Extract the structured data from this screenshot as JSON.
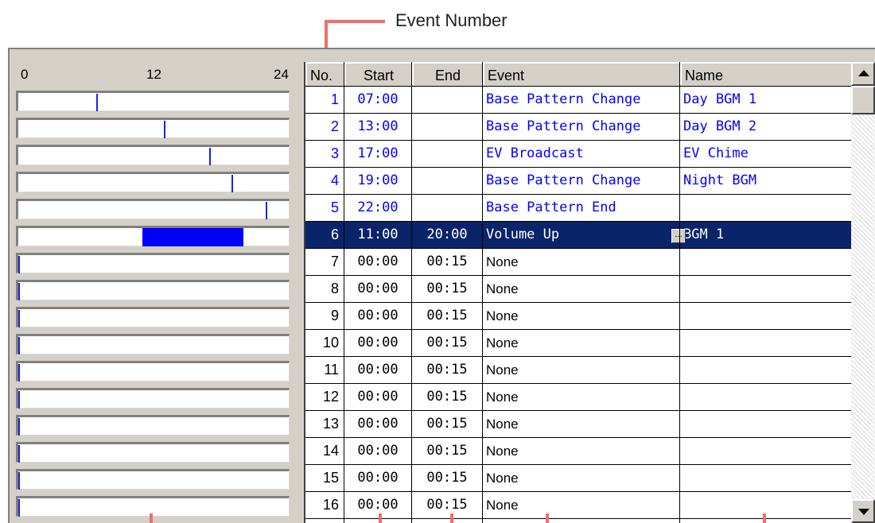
{
  "callout": {
    "label": "Event Number"
  },
  "timeline": {
    "scale": [
      "0",
      "12",
      "24"
    ],
    "range_hours": [
      0,
      24
    ],
    "marks": [
      {
        "type": "line",
        "start": 7
      },
      {
        "type": "line",
        "start": 13
      },
      {
        "type": "line",
        "start": 17
      },
      {
        "type": "line",
        "start": 19
      },
      {
        "type": "line",
        "start": 22
      },
      {
        "type": "bar",
        "start": 11,
        "end": 20
      },
      {
        "type": "line",
        "start": 0
      },
      {
        "type": "line",
        "start": 0
      },
      {
        "type": "line",
        "start": 0
      },
      {
        "type": "line",
        "start": 0
      },
      {
        "type": "line",
        "start": 0
      },
      {
        "type": "line",
        "start": 0
      },
      {
        "type": "line",
        "start": 0
      },
      {
        "type": "line",
        "start": 0
      },
      {
        "type": "line",
        "start": 0
      },
      {
        "type": "line",
        "start": 0
      }
    ]
  },
  "table": {
    "headers": {
      "no": "No.",
      "start": "Start",
      "end": "End",
      "event": "Event",
      "name": "Name"
    },
    "rows": [
      {
        "no": "1",
        "start": "07:00",
        "end": "",
        "event": "Base Pattern Change",
        "name": "Day BGM 1",
        "style": "blue"
      },
      {
        "no": "2",
        "start": "13:00",
        "end": "",
        "event": "Base Pattern Change",
        "name": "Day BGM 2",
        "style": "blue"
      },
      {
        "no": "3",
        "start": "17:00",
        "end": "",
        "event": "EV Broadcast",
        "name": "EV Chime",
        "style": "blue"
      },
      {
        "no": "4",
        "start": "19:00",
        "end": "",
        "event": "Base Pattern Change",
        "name": "Night BGM",
        "style": "blue"
      },
      {
        "no": "5",
        "start": "22:00",
        "end": "",
        "event": "Base Pattern End",
        "name": "",
        "style": "blue"
      },
      {
        "no": "6",
        "start": "11:00",
        "end": "20:00",
        "event": "Volume Up",
        "name": "BGM 1",
        "style": "selected",
        "button": "..."
      },
      {
        "no": "7",
        "start": "00:00",
        "end": "00:15",
        "event": "None",
        "name": "",
        "style": "black"
      },
      {
        "no": "8",
        "start": "00:00",
        "end": "00:15",
        "event": "None",
        "name": "",
        "style": "black"
      },
      {
        "no": "9",
        "start": "00:00",
        "end": "00:15",
        "event": "None",
        "name": "",
        "style": "black"
      },
      {
        "no": "10",
        "start": "00:00",
        "end": "00:15",
        "event": "None",
        "name": "",
        "style": "black"
      },
      {
        "no": "11",
        "start": "00:00",
        "end": "00:15",
        "event": "None",
        "name": "",
        "style": "black"
      },
      {
        "no": "12",
        "start": "00:00",
        "end": "00:15",
        "event": "None",
        "name": "",
        "style": "black"
      },
      {
        "no": "13",
        "start": "00:00",
        "end": "00:15",
        "event": "None",
        "name": "",
        "style": "black"
      },
      {
        "no": "14",
        "start": "00:00",
        "end": "00:15",
        "event": "None",
        "name": "",
        "style": "black"
      },
      {
        "no": "15",
        "start": "00:00",
        "end": "00:15",
        "event": "None",
        "name": "",
        "style": "black"
      },
      {
        "no": "16",
        "start": "00:00",
        "end": "00:15",
        "event": "None",
        "name": "",
        "style": "black"
      }
    ]
  },
  "colors": {
    "accent": "#f26d6d",
    "selection": "#0a246a",
    "event_blue": "#0000ff",
    "timeline_mark": "#1e22e6"
  },
  "icons": {
    "scroll_up": "triangle-up-icon",
    "scroll_down": "triangle-down-icon"
  }
}
